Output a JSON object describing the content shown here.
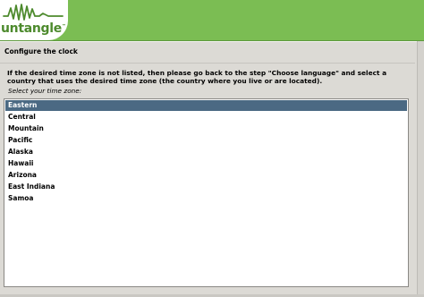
{
  "brand": {
    "name": "untangle",
    "trademark": "™"
  },
  "colors": {
    "header": "#7bbd53",
    "selection": "#4b6983"
  },
  "step": {
    "title": "Configure the clock"
  },
  "timezone": {
    "description": "If the desired time zone is not listed, then please go back to the step \"Choose language\" and select a\ncountry that uses the desired time zone (the country where you live or are located).",
    "prompt": "Select your time zone:",
    "selected": "Eastern",
    "options": [
      "Eastern",
      "Central",
      "Mountain",
      "Pacific",
      "Alaska",
      "Hawaii",
      "Arizona",
      "East Indiana",
      "Samoa"
    ]
  }
}
